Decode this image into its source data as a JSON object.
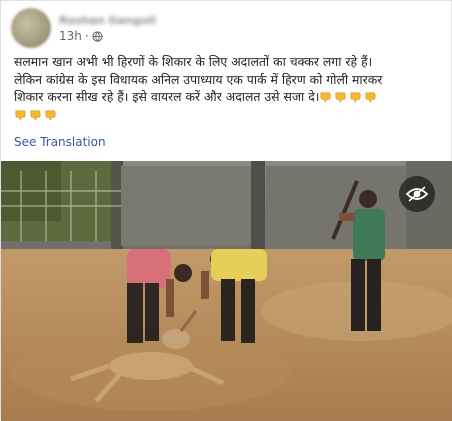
{
  "post": {
    "author_name_blurred": "Roshan Ganguli",
    "timestamp": "13h",
    "separator": "·",
    "text_lines": [
      "सलमान खान अभी भी हिरणों के शिकार के लिए अदालतों का चक्कर लगा रहे हैं।",
      "लेकिन कांग्रेस के इस विधायक अनिल उपाध्याय एक पार्क में हिरण को गोली मारकर",
      "शिकार करना सीख रहे हैं।  इसे वायरल करें और अदालत उसे सजा दे।"
    ],
    "see_translation": "See Translation"
  },
  "icons": {
    "privacy": "globe-icon",
    "emoji": "backhand-index-pointing-down-emoji",
    "video_overlay": "eye-icon"
  },
  "colors": {
    "link": "#385898",
    "meta": "#616770",
    "emoji": "#f5b82e"
  }
}
